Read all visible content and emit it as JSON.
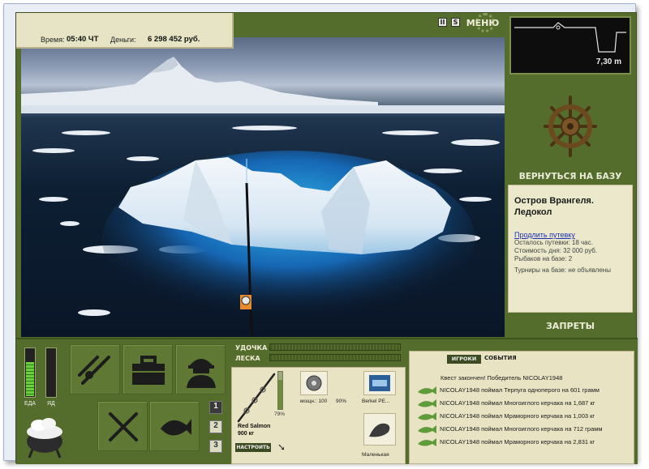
{
  "status": {
    "time_label": "Время:",
    "time_value": "05:40 ЧТ",
    "money_label": "Деньги:",
    "money_value": "6 298 452 руб."
  },
  "toolbar": {
    "pause_glyph": "II",
    "sound_glyph": "S",
    "menu_label": "МЕНЮ"
  },
  "depth": {
    "value": "7,30 m"
  },
  "navigation": {
    "return_label": "ВЕРНУТЬСЯ НА БАЗУ",
    "bans_label": "ЗАПРЕТЫ"
  },
  "location": {
    "title": "Остров Врангеля. Ледокол",
    "extend_link": "Продлить путевку",
    "remaining": "Осталось путевки: 18 час.",
    "day_cost": "Стоимость дня: 32 000 руб.",
    "anglers": "Рыбаков на базе: 2",
    "tournaments": "Турниры на базе: не объявлены"
  },
  "needs": {
    "food_label": "ЕДА",
    "food_level": 0.7,
    "poison_label": "ЯД",
    "poison_level": 0.0
  },
  "actions": [
    {
      "name": "tackle",
      "icon": "rod-icon"
    },
    {
      "name": "box",
      "icon": "tackle-box-icon"
    },
    {
      "name": "fisherman",
      "icon": "fisherman-icon"
    },
    {
      "name": "food",
      "icon": "fork-knife-icon"
    },
    {
      "name": "catch",
      "icon": "fish-icon"
    }
  ],
  "slots": {
    "one": "1",
    "two": "2",
    "three": "3"
  },
  "tension": {
    "rod_label": "УДОЧКА",
    "line_label": "ЛЕСКА"
  },
  "tackle": {
    "rod_condition": "79%",
    "rod_condition_level": 0.79,
    "rod_name": "Red Salmon",
    "rod_max_weight": "900 кг",
    "setup_label": "НАСТРОИТЬ",
    "reel_power": "мощн.: 100",
    "reel_condition": "90%",
    "line_name": "Berkel PE...",
    "lure_name": "Маленькая"
  },
  "feed": {
    "tab_players": "ИГРОКИ",
    "tab_events": "СОБЫТИЯ",
    "quest": "Квест закончен! Победитель NICOLAY1948",
    "entries": [
      "NICOLAY1948 поймал Терпуга одноперого на 601 грамм",
      "NICOLAY1948 поймал Многоиглого керчака на 1,687 кг",
      "NICOLAY1948 поймал Мраморного керчака на 1,003 кг",
      "NICOLAY1948 поймал Многоиглого керчака на 712 грамм",
      "NICOLAY1948 поймал Мраморного керчака на 2,831 кг"
    ]
  }
}
